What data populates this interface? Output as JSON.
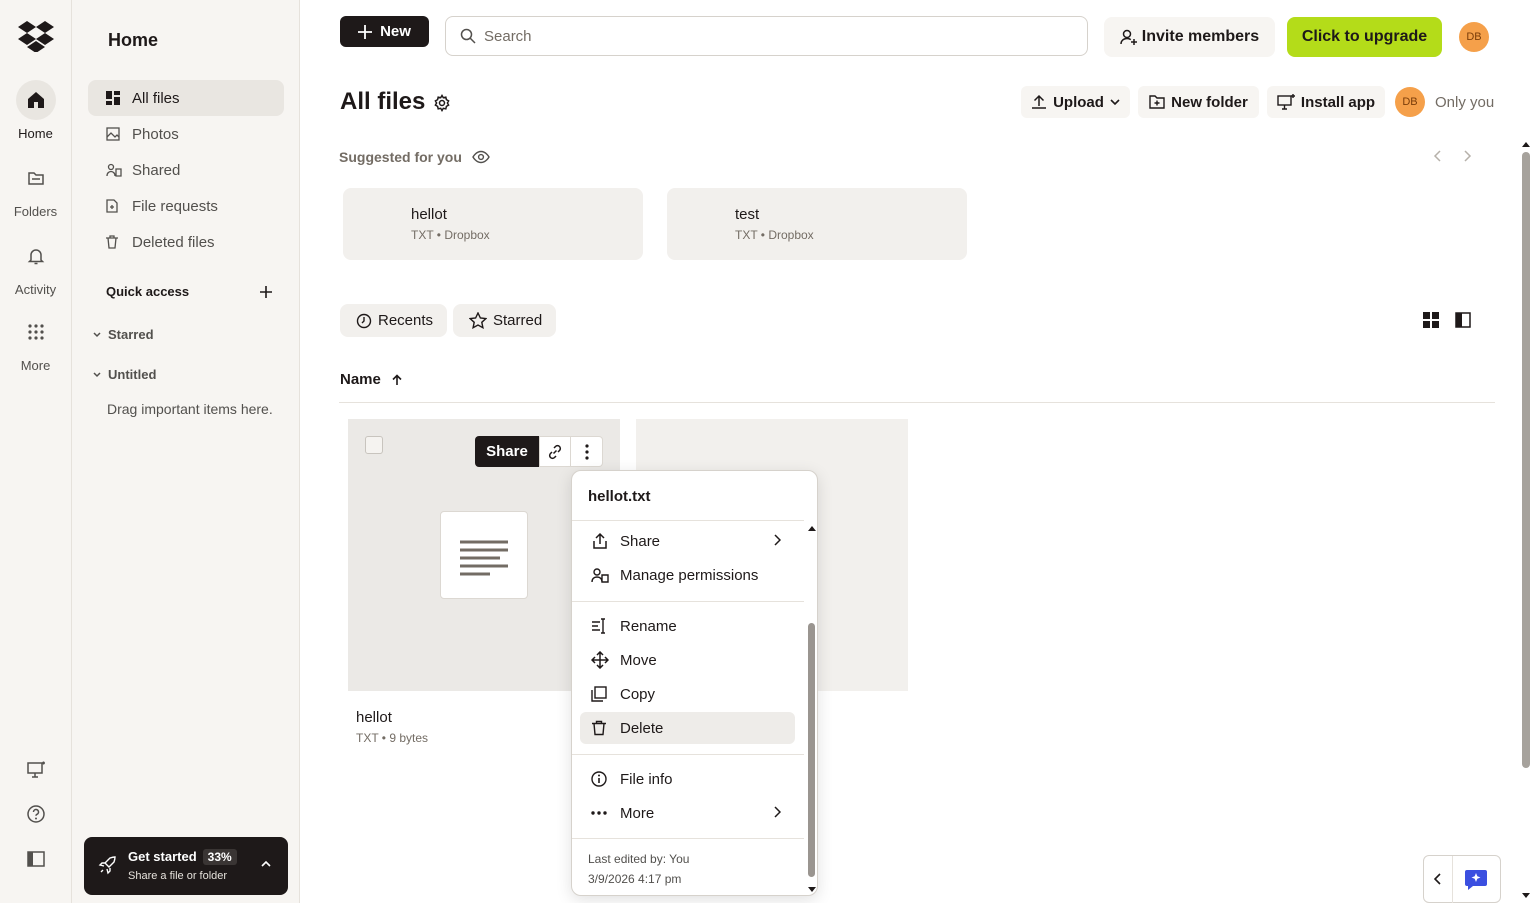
{
  "rail": {
    "items": [
      {
        "label": "Home",
        "icon": "home-icon"
      },
      {
        "label": "Folders",
        "icon": "folder-icon"
      },
      {
        "label": "Activity",
        "icon": "bell-icon"
      },
      {
        "label": "More",
        "icon": "grid-icon"
      }
    ]
  },
  "sidebar": {
    "title": "Home",
    "nav": [
      {
        "label": "All files",
        "icon": "all-files-icon"
      },
      {
        "label": "Photos",
        "icon": "photos-icon"
      },
      {
        "label": "Shared",
        "icon": "shared-icon"
      },
      {
        "label": "File requests",
        "icon": "file-request-icon"
      },
      {
        "label": "Deleted files",
        "icon": "trash-icon"
      }
    ],
    "quick_access": "Quick access",
    "groups": [
      "Starred",
      "Untitled"
    ],
    "hint": "Drag important items here.",
    "get_started": {
      "title": "Get started",
      "percent": "33%",
      "subtitle": "Share a file or folder"
    }
  },
  "topbar": {
    "new_label": "New",
    "search_placeholder": "Search",
    "invite_label": "Invite members",
    "upgrade_label": "Click to upgrade",
    "avatar_initials": "DB"
  },
  "main": {
    "title": "All files",
    "upload_label": "Upload",
    "new_folder_label": "New folder",
    "install_app_label": "Install app",
    "owner_initials": "DB",
    "visibility_label": "Only you",
    "suggested_label": "Suggested for you",
    "suggested": [
      {
        "name": "hellot",
        "meta": "TXT • Dropbox"
      },
      {
        "name": "test",
        "meta": "TXT • Dropbox"
      }
    ],
    "filters": [
      {
        "label": "Recents",
        "icon": "clock-icon"
      },
      {
        "label": "Starred",
        "icon": "star-icon"
      }
    ],
    "sort_column": "Name",
    "files": [
      {
        "name": "hellot",
        "meta": "TXT • 9 bytes"
      }
    ],
    "tile_share_label": "Share"
  },
  "context_menu": {
    "title": "hellot.txt",
    "items": [
      {
        "label": "Share",
        "icon": "share-icon"
      },
      {
        "label": "Manage permissions",
        "icon": "permissions-icon"
      },
      {
        "label": "Rename",
        "icon": "rename-icon"
      },
      {
        "label": "Move",
        "icon": "move-icon"
      },
      {
        "label": "Copy",
        "icon": "copy-icon"
      },
      {
        "label": "Delete",
        "icon": "trash-icon"
      },
      {
        "label": "File info",
        "icon": "info-icon"
      },
      {
        "label": "More",
        "icon": "more-icon"
      }
    ],
    "last_edited": "Last edited by: You",
    "timestamp": "3/9/2026 4:17 pm"
  },
  "colors": {
    "accent_upgrade": "#b4dc19",
    "dark": "#1e1919",
    "avatar": "#f5a04a",
    "sidebar_bg": "#f7f5f2"
  }
}
